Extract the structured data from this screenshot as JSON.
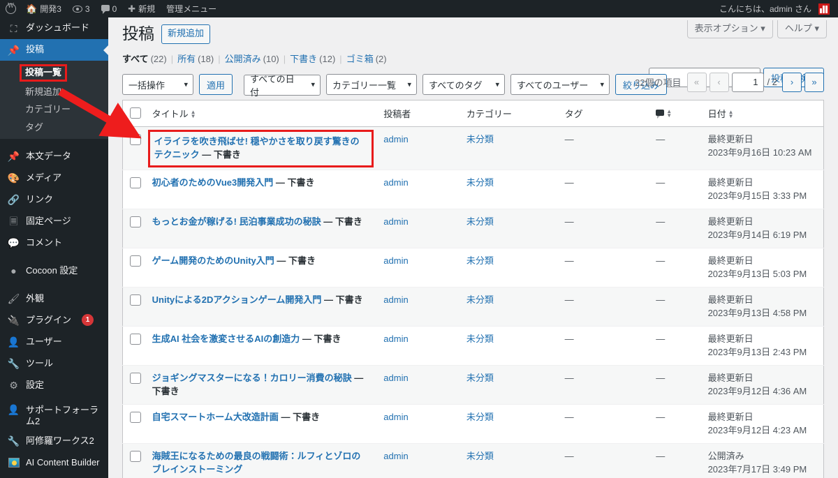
{
  "adminbar": {
    "logo_icon": "wordpress-logo-icon",
    "site_name": "開発3",
    "updates_count": "3",
    "comments_count": "0",
    "new_label": "新規",
    "admin_menu_label": "管理メニュー",
    "greeting": "こんにちは、admin さん"
  },
  "sidebar": {
    "items": [
      {
        "label": "ダッシュボード",
        "icon": "dashboard-icon",
        "current": false
      },
      {
        "label": "投稿",
        "icon": "pin-icon",
        "current": true
      },
      {
        "label": "本文データ",
        "icon": "pin-icon",
        "current": false
      },
      {
        "label": "メディア",
        "icon": "media-icon",
        "current": false
      },
      {
        "label": "リンク",
        "icon": "link-icon",
        "current": false
      },
      {
        "label": "固定ページ",
        "icon": "page-icon",
        "current": false
      },
      {
        "label": "コメント",
        "icon": "comment-icon",
        "current": false
      },
      {
        "label": "Cocoon 設定",
        "icon": "circle-icon",
        "current": false
      },
      {
        "label": "外観",
        "icon": "brush-icon",
        "current": false
      },
      {
        "label": "プラグイン",
        "icon": "plugin-icon",
        "badge": "1",
        "current": false
      },
      {
        "label": "ユーザー",
        "icon": "user-icon",
        "current": false
      },
      {
        "label": "ツール",
        "icon": "wrench-icon",
        "current": false
      },
      {
        "label": "設定",
        "icon": "settings-icon",
        "current": false
      },
      {
        "label": "サポートフォーラム2",
        "icon": "support-icon",
        "current": false
      },
      {
        "label": "阿修羅ワークス2",
        "icon": "wrench-icon",
        "current": false
      },
      {
        "label": "AI Content Builder",
        "icon": "ai-content-builder-icon",
        "current": false
      }
    ],
    "submenu": [
      {
        "label": "投稿一覧",
        "current": true,
        "highlighted": true
      },
      {
        "label": "新規追加",
        "current": false
      },
      {
        "label": "カテゴリー",
        "current": false
      },
      {
        "label": "タグ",
        "current": false
      }
    ]
  },
  "screen_meta": {
    "display_options": "表示オプション",
    "help": "ヘルプ"
  },
  "page": {
    "title": "投稿",
    "add_new": "新規追加"
  },
  "views": [
    {
      "label": "すべて",
      "count": "(22)",
      "current": true
    },
    {
      "label": "所有",
      "count": "(18)",
      "current": false
    },
    {
      "label": "公開済み",
      "count": "(10)",
      "current": false
    },
    {
      "label": "下書き",
      "count": "(12)",
      "current": false
    },
    {
      "label": "ゴミ箱",
      "count": "(2)",
      "current": false
    }
  ],
  "search": {
    "value": "",
    "placeholder": "",
    "button": "投稿を検索"
  },
  "toolbar": {
    "bulk_actions": "一括操作",
    "apply": "適用",
    "date_filter": "すべての日付",
    "category_filter": "カテゴリー一覧",
    "tag_filter": "すべてのタグ",
    "user_filter": "すべてのユーザー",
    "filter_button": "絞り込み"
  },
  "pagination": {
    "total_items": "22個の項目",
    "first": "«",
    "prev": "‹",
    "current_page": "1",
    "total_pages": "/ 2",
    "next": "›",
    "last": "»"
  },
  "table": {
    "columns": {
      "title": "タイトル",
      "author": "投稿者",
      "categories": "カテゴリー",
      "tags": "タグ",
      "comments": "comment-icon",
      "date": "日付"
    },
    "rows": [
      {
        "title": "イライラを吹き飛ばせ! 穏やかさを取り戻す驚きのテクニック",
        "state": "— 下書き",
        "author": "admin",
        "category": "未分類",
        "tags": "—",
        "comments": "—",
        "date_status": "最終更新日",
        "date_value": "2023年9月16日 10:23 AM",
        "highlighted": true
      },
      {
        "title": "初心者のためのVue3開発入門",
        "state": "— 下書き",
        "author": "admin",
        "category": "未分類",
        "tags": "—",
        "comments": "—",
        "date_status": "最終更新日",
        "date_value": "2023年9月15日 3:33 PM",
        "highlighted": false
      },
      {
        "title": "もっとお金が稼げる! 民泊事業成功の秘訣",
        "state": "— 下書き",
        "author": "admin",
        "category": "未分類",
        "tags": "—",
        "comments": "—",
        "date_status": "最終更新日",
        "date_value": "2023年9月14日 6:19 PM",
        "highlighted": false
      },
      {
        "title": "ゲーム開発のためのUnity入門",
        "state": "— 下書き",
        "author": "admin",
        "category": "未分類",
        "tags": "—",
        "comments": "—",
        "date_status": "最終更新日",
        "date_value": "2023年9月13日 5:03 PM",
        "highlighted": false
      },
      {
        "title": "Unityによる2Dアクションゲーム開発入門",
        "state": "— 下書き",
        "author": "admin",
        "category": "未分類",
        "tags": "—",
        "comments": "—",
        "date_status": "最終更新日",
        "date_value": "2023年9月13日 4:58 PM",
        "highlighted": false
      },
      {
        "title": "生成AI 社会を激変させるAIの創造力",
        "state": "— 下書き",
        "author": "admin",
        "category": "未分類",
        "tags": "—",
        "comments": "—",
        "date_status": "最終更新日",
        "date_value": "2023年9月13日 2:43 PM",
        "highlighted": false
      },
      {
        "title": "ジョギングマスターになる！カロリー消費の秘訣",
        "state": "— 下書き",
        "author": "admin",
        "category": "未分類",
        "tags": "—",
        "comments": "—",
        "date_status": "最終更新日",
        "date_value": "2023年9月12日 4:36 AM",
        "highlighted": false
      },
      {
        "title": "自宅スマートホーム大改造計画",
        "state": "— 下書き",
        "author": "admin",
        "category": "未分類",
        "tags": "—",
        "comments": "—",
        "date_status": "最終更新日",
        "date_value": "2023年9月12日 4:23 AM",
        "highlighted": false
      },
      {
        "title": "海賊王になるための最良の戦闘術：ルフィとゾロのブレインストーミング",
        "state": "",
        "author": "admin",
        "category": "未分類",
        "tags": "—",
        "comments": "—",
        "date_status": "公開済み",
        "date_value": "2023年7月17日 3:49 PM",
        "highlighted": false
      }
    ]
  },
  "annotation": {
    "arrow_color": "#ee1d1d",
    "highlight_color": "#e81b1b"
  }
}
